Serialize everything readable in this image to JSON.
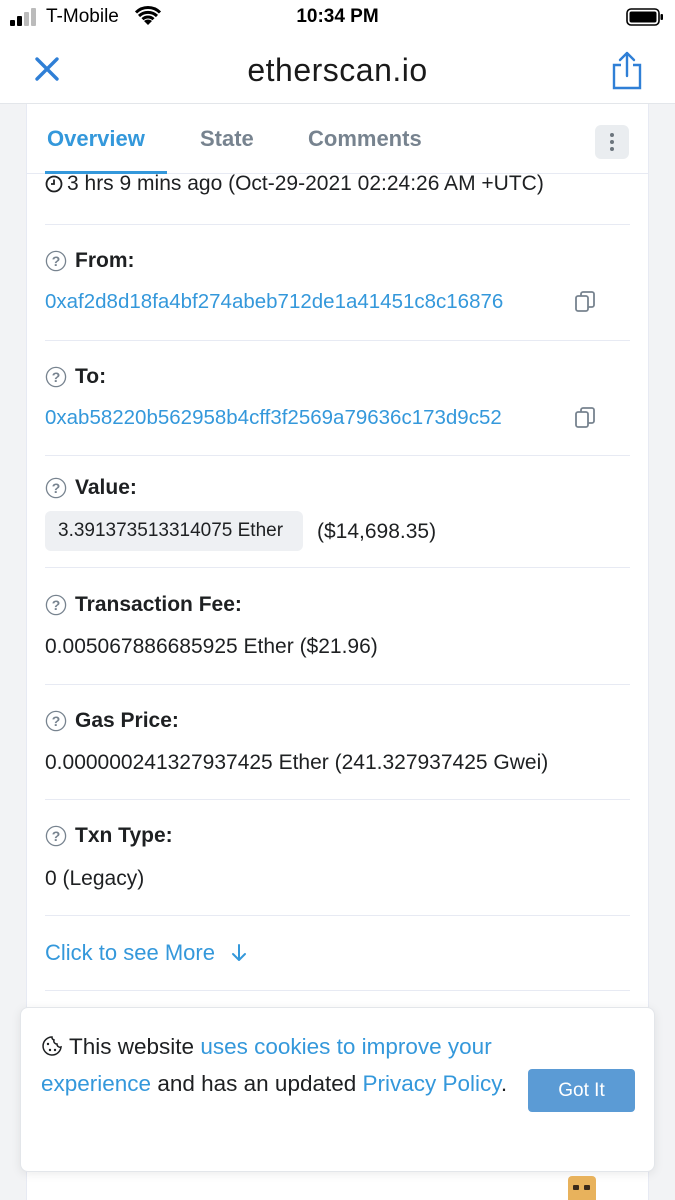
{
  "status_bar": {
    "carrier": "T-Mobile",
    "time": "10:34 PM"
  },
  "browser": {
    "title": "etherscan.io",
    "close_icon": "close-icon",
    "share_icon": "share-icon"
  },
  "tabs": [
    {
      "label": "Overview",
      "active": true
    },
    {
      "label": "State",
      "active": false
    },
    {
      "label": "Comments",
      "active": false
    }
  ],
  "transaction": {
    "timestamp": "3 hrs 9 mins ago (Oct-29-2021 02:24:26 AM +UTC)",
    "from_label": "From:",
    "from_address": "0xaf2d8d18fa4bf274abeb712de1a41451c8c16876",
    "to_label": "To:",
    "to_address": "0xab58220b562958b4cff3f2569a79636c173d9c52",
    "value_label": "Value:",
    "value_ether": "3.391373513314075 Ether",
    "value_usd": "($14,698.35)",
    "fee_label": "Transaction Fee:",
    "fee_value": "0.005067886685925 Ether ($21.96)",
    "gas_label": "Gas Price:",
    "gas_value": "0.000000241327937425 Ether (241.327937425 Gwei)",
    "type_label": "Txn Type:",
    "type_value": "0 (Legacy)"
  },
  "see_more": "Click to see More",
  "cookie": {
    "text_1": "This website ",
    "link_1": "uses cookies to improve your experience",
    "text_2": " and has an updated ",
    "link_2": "Privacy Policy",
    "text_3": ".",
    "button": "Got It"
  },
  "colors": {
    "link": "#3498db",
    "button": "#5b9bd5"
  }
}
